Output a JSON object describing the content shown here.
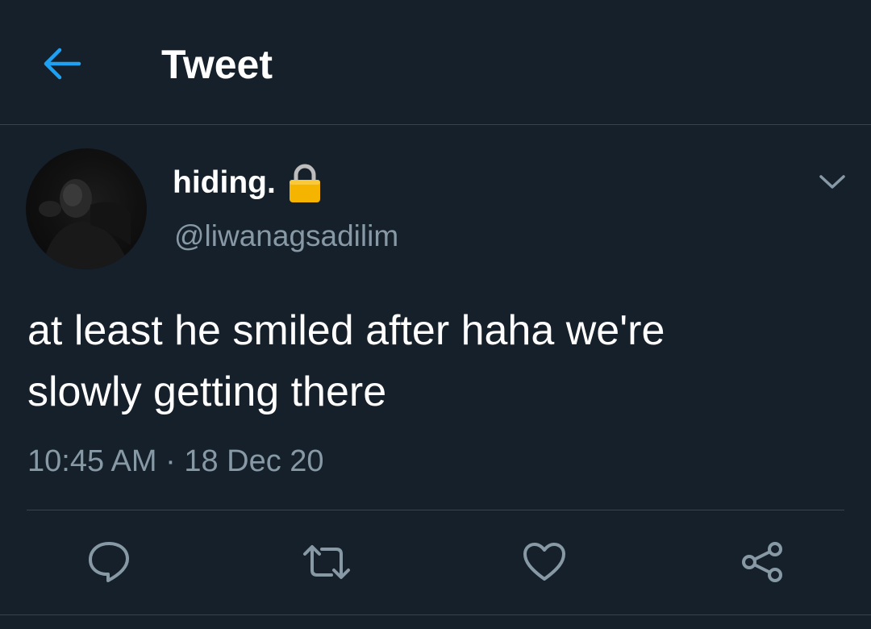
{
  "colors": {
    "background": "#15202b",
    "accent": "#1da1f2",
    "secondary_text": "#8899a6",
    "divider": "#38444d",
    "lock": "#f4b400"
  },
  "header": {
    "back_icon": "arrow-left-icon",
    "title": "Tweet"
  },
  "tweet": {
    "author": {
      "display_name": "hiding.",
      "protected_icon": "lock-icon",
      "handle": "@liwanagsadilim"
    },
    "menu_icon": "chevron-down-icon",
    "text": "at least he smiled after haha we're\nslowly getting there",
    "timestamp": "10:45 AM · 18 Dec 20",
    "actions": [
      {
        "name": "reply",
        "icon": "comment-icon"
      },
      {
        "name": "retweet",
        "icon": "retweet-icon"
      },
      {
        "name": "like",
        "icon": "heart-icon"
      },
      {
        "name": "share",
        "icon": "share-icon"
      }
    ]
  }
}
